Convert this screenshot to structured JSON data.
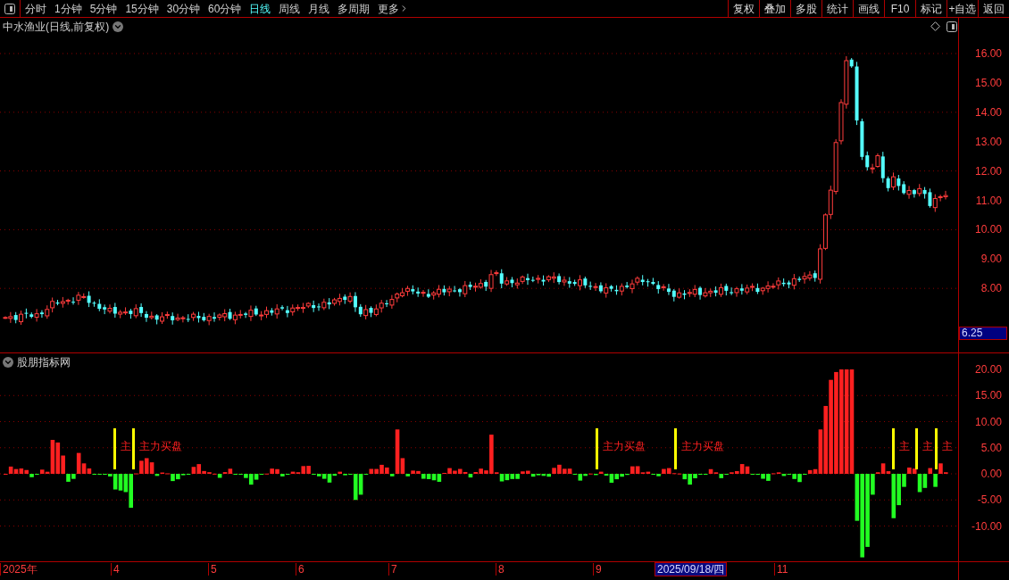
{
  "toolbar": {
    "periods": [
      {
        "label": "分时",
        "selected": false
      },
      {
        "label": "1分钟",
        "selected": false
      },
      {
        "label": "5分钟",
        "selected": false
      },
      {
        "label": "15分钟",
        "selected": false
      },
      {
        "label": "30分钟",
        "selected": false
      },
      {
        "label": "60分钟",
        "selected": false
      },
      {
        "label": "日线",
        "selected": true
      },
      {
        "label": "周线",
        "selected": false
      },
      {
        "label": "月线",
        "selected": false
      },
      {
        "label": "多周期",
        "selected": false
      }
    ],
    "more": "更多",
    "actions": [
      "复权",
      "叠加",
      "多股",
      "统计",
      "画线",
      "F10",
      "标记",
      "+自选",
      "返回"
    ]
  },
  "price_pane": {
    "title": "中水渔业(日线,前复权)",
    "axis_labels": [
      "16.00",
      "15.00",
      "14.00",
      "13.00",
      "12.00",
      "11.00",
      "10.00",
      "9.00",
      "8.00"
    ],
    "current_price": "6.25"
  },
  "indicator_pane": {
    "title": "股朋指标网",
    "axis_labels": [
      "20.00",
      "15.00",
      "10.00",
      "5.00",
      "0.00",
      "-5.00",
      "-10.00"
    ],
    "signals": [
      {
        "label": "主"
      },
      {
        "label": "主力买盘"
      },
      {
        "label": "主力买盘"
      },
      {
        "label": "主力买盘"
      },
      {
        "label": "主"
      },
      {
        "label": "主"
      },
      {
        "label": "主"
      }
    ]
  },
  "date_axis": {
    "labels": [
      "2025年",
      "4",
      "5",
      "6",
      "7",
      "8",
      "9",
      "11"
    ],
    "cursor_date": "2025/09/18/四"
  }
}
